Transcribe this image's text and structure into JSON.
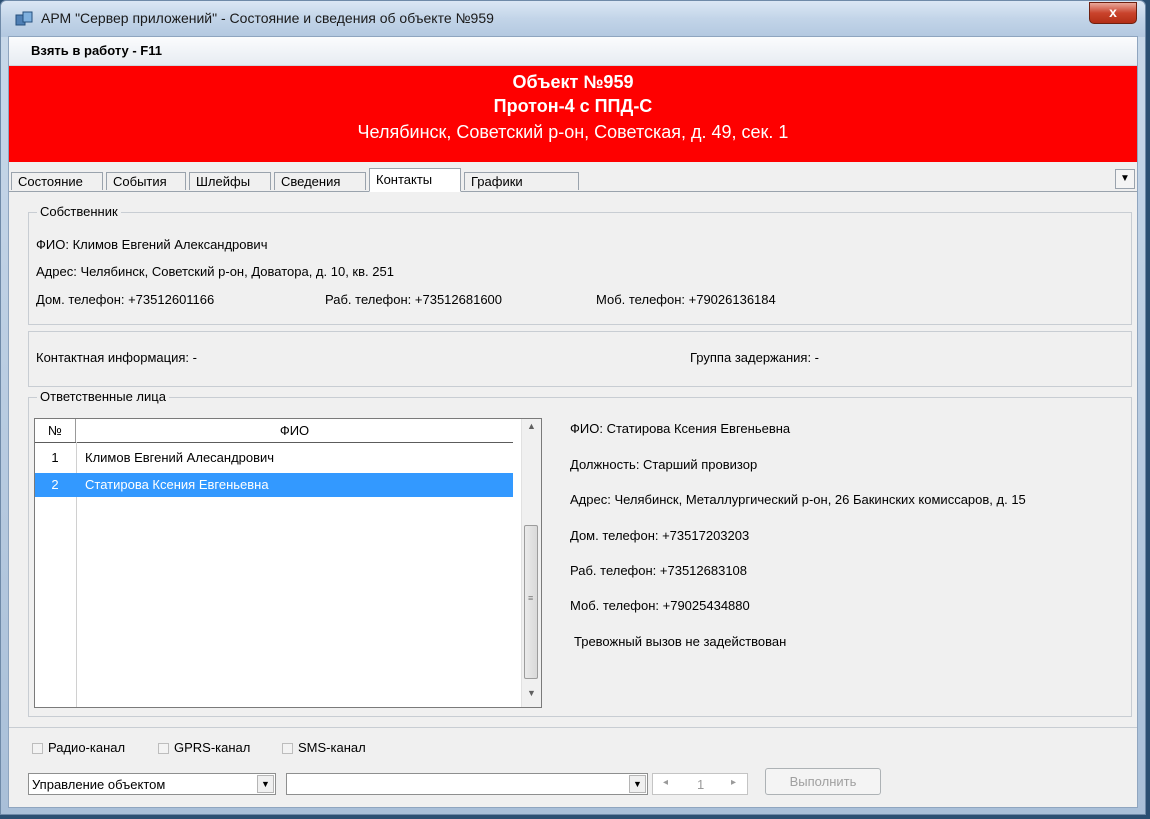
{
  "window": {
    "title": "АРМ \"Сервер приложений\" - Состояние и сведения об объекте №959",
    "close_label": "x"
  },
  "menu": {
    "take_to_work": "Взять в работу - F11"
  },
  "banner": {
    "line1": "Объект №959",
    "line2": "Протон-4 с ППД-С",
    "line3": "Челябинск, Советский р-он, Советская, д. 49, сек. 1",
    "color": "#fe0000"
  },
  "tabs": [
    {
      "label": "Состояние"
    },
    {
      "label": "События"
    },
    {
      "label": "Шлейфы"
    },
    {
      "label": "Сведения"
    },
    {
      "label": "Контакты"
    },
    {
      "label": "Графики"
    }
  ],
  "owner": {
    "legend": "Собственник",
    "fio": "ФИО:  Климов Евгений Александрович",
    "address": "Адрес:  Челябинск, Советский р-он, Доватора, д. 10, кв. 251",
    "home_phone": "Дом. телефон:  +73512601166",
    "work_phone": "Раб. телефон:  +73512681600",
    "mobile_phone": "Моб. телефон:  +79026136184"
  },
  "contact_info": {
    "contact": "Контактная информация:  -",
    "group": "Группа задержания:  -"
  },
  "responsible": {
    "legend": "Ответственные лица",
    "columns": {
      "num": "№",
      "fio": "ФИО"
    },
    "rows": [
      {
        "num": "1",
        "fio": "Климов Евгений Алесандрович"
      },
      {
        "num": "2",
        "fio": "Статирова Ксения Евгеньевна"
      }
    ],
    "detail": {
      "fio": "ФИО:  Статирова Ксения Евгеньевна",
      "position": "Должность:  Старший провизор",
      "address": "Адрес:  Челябинск, Металлургический р-он, 26 Бакинских комиссаров, д. 15",
      "home_phone": "Дом. телефон:  +73517203203",
      "work_phone": "Раб. телефон:  +73512683108",
      "mobile_phone": "Моб. телефон:  +79025434880",
      "alarm": "Тревожный вызов не задействован"
    }
  },
  "channels": {
    "radio": "Радио-канал",
    "gprs": "GPRS-канал",
    "sms": "SMS-канал"
  },
  "bottom": {
    "combo1_value": "Управление объектом",
    "combo2_value": "",
    "spin_value": "1",
    "execute_label": "Выполнить"
  }
}
